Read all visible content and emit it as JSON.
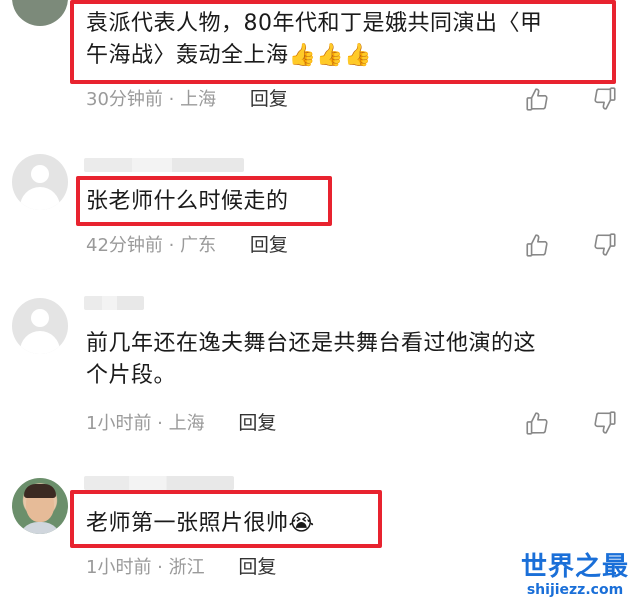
{
  "comments": [
    {
      "text_line1": "袁派代表人物，80年代和丁是娥共同演出〈甲",
      "text_line2": "午海战〉轰动全上海",
      "time": "30分钟前 · 上海",
      "reply": "回复"
    },
    {
      "text_line1": "张老师什么时候走的",
      "time": "42分钟前 · 广东",
      "reply": "回复"
    },
    {
      "text_line1": "前几年还在逸夫舞台还是共舞台看过他演的这",
      "text_line2": "个片段。",
      "time": "1小时前 · 上海",
      "reply": "回复"
    },
    {
      "text_line1": "老师第一张照片很帅",
      "time": "1小时前 · 浙江",
      "reply": "回复"
    }
  ],
  "icons": {
    "like": "thumbs-up-icon",
    "dislike": "thumbs-down-icon",
    "applause": "thumbs-up-emoji",
    "cry": "crying-emoji"
  },
  "colors": {
    "highlight": "#e8232f",
    "meta": "#9a9a9a",
    "watermark": "#1a6fd8"
  },
  "watermark": {
    "title": "世界之最",
    "subtitle": "shijiezz.com"
  }
}
